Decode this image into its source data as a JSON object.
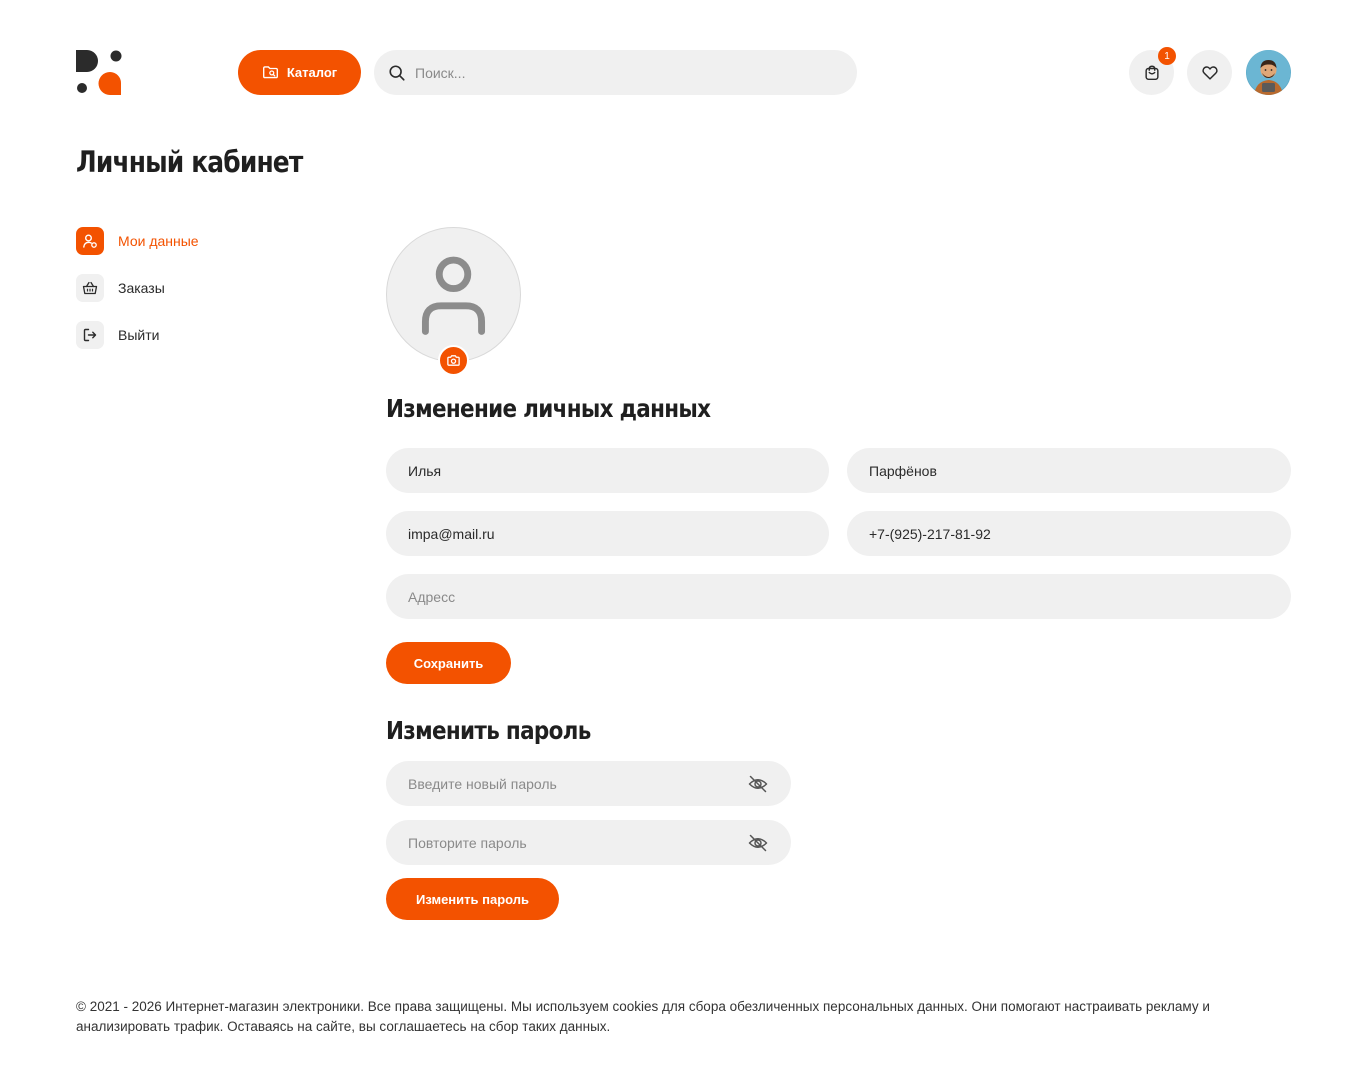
{
  "header": {
    "catalog_label": "Каталог",
    "search_placeholder": "Поиск...",
    "cart_count": "1"
  },
  "page": {
    "title": "Личный кабинет"
  },
  "sidebar": {
    "items": [
      {
        "label": "Мои данные",
        "icon": "user-edit-icon",
        "active": true
      },
      {
        "label": "Заказы",
        "icon": "basket-icon",
        "active": false
      },
      {
        "label": "Выйти",
        "icon": "logout-icon",
        "active": false
      }
    ]
  },
  "profile": {
    "section_title": "Изменение личных данных",
    "first_name": "Илья",
    "last_name": "Парфёнов",
    "email": "impa@mail.ru",
    "phone": "+7-(925)-217-81-92",
    "address_placeholder": "Адресс",
    "save_label": "Сохранить"
  },
  "password": {
    "section_title": "Изменить пароль",
    "new_placeholder": "Введите новый пароль",
    "repeat_placeholder": "Повторите пароль",
    "submit_label": "Изменить пароль"
  },
  "footer": {
    "text": "© 2021 - 2026 Интернет-магазин электроники. Все права защищены. Мы используем cookies для сбора обезличенных персональных данных. Они помогают настраивать рекламу и анализировать трафик. Оставаясь на сайте, вы соглашаетесь на сбор таких данных."
  },
  "colors": {
    "accent": "#f35200",
    "field_bg": "#f0f0f0",
    "text": "#222222"
  }
}
